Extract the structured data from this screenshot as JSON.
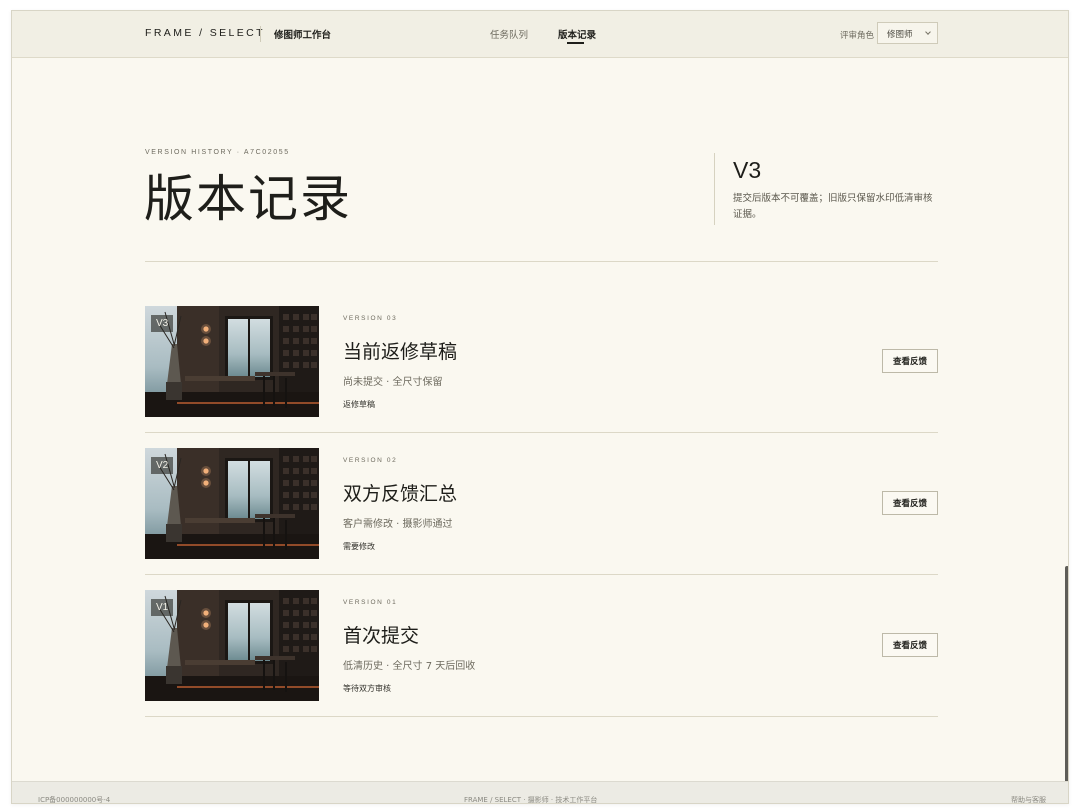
{
  "header": {
    "brand": "FRAME / SELECT",
    "workspace": "修图师工作台",
    "nav": [
      {
        "label": "任务队列",
        "active": false
      },
      {
        "label": "版本记录",
        "active": true
      }
    ],
    "role_label": "评审角色",
    "role_value": "修图师"
  },
  "intro": {
    "eyebrow": "VERSION HISTORY · A7C02055",
    "title": "版本记录",
    "current_version": "V3",
    "note": "提交后版本不可覆盖；旧版只保留水印低清审核证据。"
  },
  "versions": [
    {
      "badge": "V3",
      "eyebrow": "VERSION 03",
      "title": "当前返修草稿",
      "meta": "尚未提交 · 全尺寸保留",
      "status": "返修草稿",
      "button": "查看反馈"
    },
    {
      "badge": "V2",
      "eyebrow": "VERSION 02",
      "title": "双方反馈汇总",
      "meta": "客户需修改 · 摄影师通过",
      "status": "需要修改",
      "button": "查看反馈"
    },
    {
      "badge": "V1",
      "eyebrow": "VERSION 01",
      "title": "首次提交",
      "meta": "低清历史 · 全尺寸 7 天后回收",
      "status": "等待双方审核",
      "button": "查看反馈"
    }
  ],
  "footer": {
    "left": "ICP备000000000号-4",
    "center": "FRAME / SELECT · 摄影师 · 技术工作平台",
    "right": "帮助与客服"
  },
  "colors": {
    "background": "#faf8f0",
    "topbar": "#f1efe4",
    "text": "#1e1e1a",
    "muted": "#6d6a5e",
    "divider": "#dcd8c7"
  },
  "icons": {
    "role_select": "chevron-down-icon"
  }
}
